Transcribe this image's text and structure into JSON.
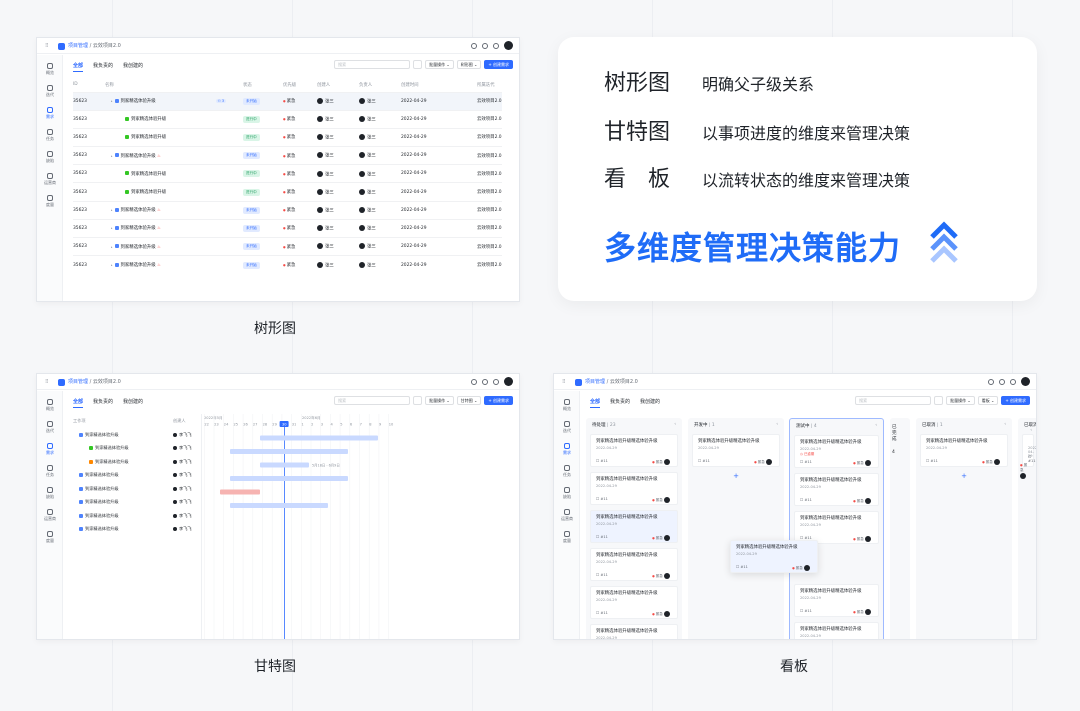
{
  "common": {
    "breadcrumb_app": "项目管理",
    "breadcrumb_sep": "/",
    "breadcrumb_project": "云效项目2.0",
    "tabs": [
      "全部",
      "我负责的",
      "我创建的"
    ],
    "search_placeholder": "搜索",
    "batch_label": "批量操作 ⌄",
    "create_label": "+ 创建需求",
    "sidebar": [
      "概览",
      "迭代",
      "需求",
      "任务",
      "缺陷",
      "运营商",
      "度量"
    ]
  },
  "tree": {
    "view_label": "树形图 ⌄",
    "columns": [
      "ID",
      "名称",
      "状态",
      "优先级",
      "创建人",
      "负责人",
      "创建时间",
      "所属迭代"
    ],
    "rows": [
      {
        "id": "35623",
        "name": "到家精选体验升级",
        "status": "未开始",
        "priority": "紧急",
        "creator": "张三",
        "owner": "张三",
        "date": "2022-04-29",
        "iteration": "云效项目2.0",
        "child_count": "3"
      },
      {
        "id": "35623",
        "name": "到家精选体验升级",
        "status": "进行中",
        "priority": "紧急",
        "creator": "张三",
        "owner": "张三",
        "date": "2022-04-29",
        "iteration": "云效项目2.0"
      },
      {
        "id": "35623",
        "name": "到家精选体验升级",
        "status": "进行中",
        "priority": "紧急",
        "creator": "张三",
        "owner": "张三",
        "date": "2022-04-29",
        "iteration": "云效项目2.0"
      },
      {
        "id": "35623",
        "name": "到家精选体验升级",
        "status": "未开始",
        "priority": "紧急",
        "creator": "张三",
        "owner": "张三",
        "date": "2022-04-29",
        "iteration": "云效项目2.0"
      },
      {
        "id": "35623",
        "name": "到家精选体验升级",
        "status": "进行中",
        "priority": "紧急",
        "creator": "张三",
        "owner": "张三",
        "date": "2022-04-29",
        "iteration": "云效项目2.0"
      },
      {
        "id": "35623",
        "name": "到家精选体验升级",
        "status": "进行中",
        "priority": "紧急",
        "creator": "张三",
        "owner": "张三",
        "date": "2022-04-29",
        "iteration": "云效项目2.0"
      },
      {
        "id": "35623",
        "name": "到家精选体验升级",
        "status": "未开始",
        "priority": "紧急",
        "creator": "张三",
        "owner": "张三",
        "date": "2022-04-29",
        "iteration": "云效项目2.0"
      },
      {
        "id": "35623",
        "name": "到家精选体验升级",
        "status": "未开始",
        "priority": "紧急",
        "creator": "张三",
        "owner": "张三",
        "date": "2022-04-29",
        "iteration": "云效项目2.0"
      },
      {
        "id": "35623",
        "name": "到家精选体验升级",
        "status": "未开始",
        "priority": "紧急",
        "creator": "张三",
        "owner": "张三",
        "date": "2022-04-29",
        "iteration": "云效项目2.0"
      },
      {
        "id": "35623",
        "name": "到家精选体验升级",
        "status": "未开始",
        "priority": "紧急",
        "creator": "张三",
        "owner": "张三",
        "date": "2022-04-29",
        "iteration": "云效项目2.0"
      }
    ]
  },
  "gantt": {
    "view_label": "甘特图 ⌄",
    "col_item": "工作项",
    "col_creator": "创建人",
    "month_a": "2022年5月",
    "month_b": "2022年6月",
    "days": [
      "22",
      "23",
      "24",
      "25",
      "26",
      "27",
      "28",
      "29",
      "30",
      "31",
      "1",
      "2",
      "3",
      "4",
      "5",
      "6",
      "7",
      "8",
      "9",
      "10"
    ],
    "today_day": "30",
    "range_note": "5月18日 - 6月9日",
    "rows": [
      {
        "name": "到家精选体验升级",
        "who": "李飞飞"
      },
      {
        "name": "到家精选体验升级",
        "who": "李飞飞"
      },
      {
        "name": "到家精选体验升级",
        "who": "李飞飞"
      },
      {
        "name": "到家精选体验升级",
        "who": "李飞飞"
      },
      {
        "name": "到家精选体验升级",
        "who": "李飞飞"
      },
      {
        "name": "到家精选体验升级",
        "who": "李飞飞"
      },
      {
        "name": "到家精选体验升级",
        "who": "李飞飞"
      },
      {
        "name": "到家精选体验升级",
        "who": "李飞飞"
      }
    ]
  },
  "kanban": {
    "view_label": "看板 ⌄",
    "columns": [
      {
        "name": "待处理",
        "count": "23"
      },
      {
        "name": "开发中",
        "count": "1"
      },
      {
        "name": "测试中",
        "count": "4"
      },
      {
        "name": "已完成",
        "count": "4"
      },
      {
        "name": "已取消",
        "count": "1"
      },
      {
        "name": "已取消",
        "count": ""
      }
    ],
    "card_title": "到家精选体验升级精选体验升级",
    "card_date": "2022-04-29",
    "card_id": "#11",
    "card_priority": "紧急",
    "overdue": "已逾期",
    "plus": "+"
  },
  "labels": {
    "tree": "树形图",
    "gantt": "甘特图",
    "kanban": "看板"
  },
  "features": [
    {
      "key": "树形图",
      "desc": "明确父子级关系"
    },
    {
      "key": "甘特图",
      "desc": "以事项进度的维度来管理决策"
    },
    {
      "key": "看　板",
      "desc": "以流转状态的维度来管理决策"
    }
  ],
  "headline": "多维度管理决策能力",
  "colors": {
    "accent": "#2f6bff",
    "headline": "#1f6cf7"
  }
}
